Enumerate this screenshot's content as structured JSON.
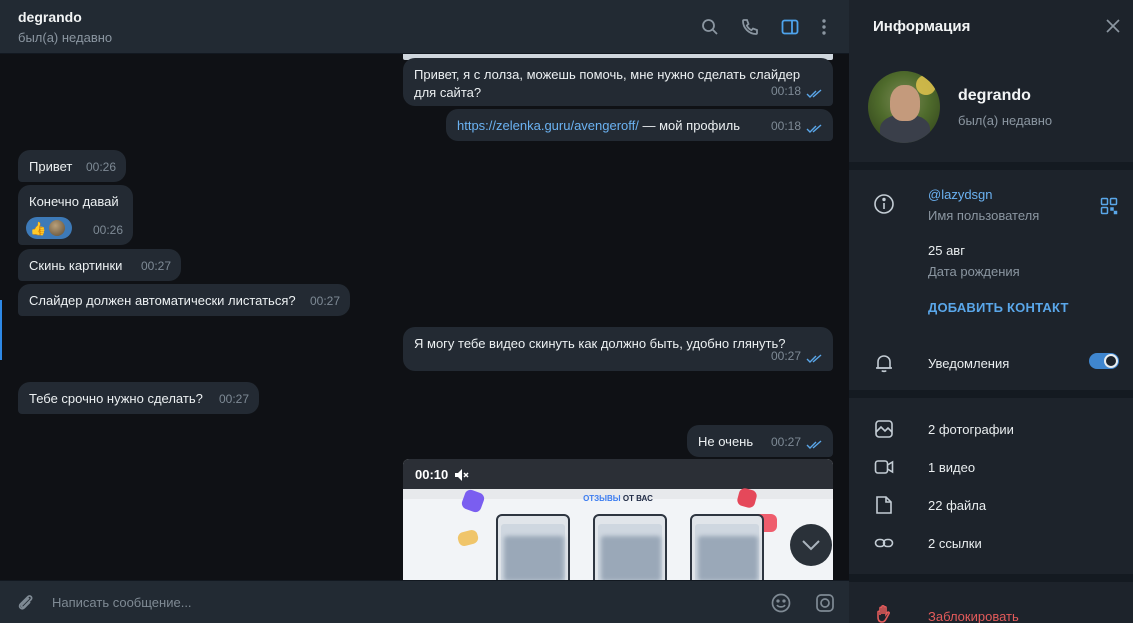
{
  "chat": {
    "contact_name": "degrando",
    "contact_status": "был(а) недавно",
    "icons": [
      "search-icon",
      "phone-icon",
      "sidebar-toggle-icon",
      "more-vert-icon"
    ]
  },
  "messages": [
    {
      "dir": "out",
      "text": "Привет, я с лолза, можешь помочь, мне нужно сделать слайдер для сайта?",
      "time": "00:18"
    },
    {
      "dir": "out",
      "link": "https://zelenka.guru/avengeroff/",
      "text_after": " — мой профиль",
      "time": "00:18"
    },
    {
      "dir": "in",
      "text": "Привет",
      "time": "00:26"
    },
    {
      "dir": "in",
      "text": "Конечно давай",
      "time": "00:26",
      "reaction": "👍"
    },
    {
      "dir": "in",
      "text": "Скинь картинки",
      "time": "00:27"
    },
    {
      "dir": "in",
      "text": "Слайдер должен автоматически листаться?",
      "time": "00:27"
    },
    {
      "dir": "out",
      "text": "Я могу тебе видео скинуть как должно быть, удобно глянуть?",
      "time": "00:27"
    },
    {
      "dir": "in",
      "text": "Тебе срочно нужно сделать?",
      "time": "00:27"
    },
    {
      "dir": "out",
      "text": "Не очень",
      "time": "00:27"
    }
  ],
  "video": {
    "time": "00:10",
    "headline_accent": "ОТЗЫВЫ",
    "headline_rest": " ОТ ВАС"
  },
  "composer": {
    "placeholder": "Написать сообщение..."
  },
  "info": {
    "title": "Информация",
    "name": "degrando",
    "status": "был(а) недавно",
    "username": "@lazydsgn",
    "username_label": "Имя пользователя",
    "birthday": "25 авг",
    "birthday_label": "Дата рождения",
    "add_contact": "ДОБАВИТЬ КОНТАКТ",
    "notifications": "Уведомления",
    "notifications_on": true,
    "media": {
      "photos": "2 фотографии",
      "videos": "1 видео",
      "files": "22 файла",
      "links": "2 ссылки"
    },
    "block": "Заблокировать"
  },
  "colors": {
    "accent": "#6bb2f2",
    "danger": "#e35b5b",
    "bubble": "#232a33",
    "panel": "#1d232b"
  }
}
